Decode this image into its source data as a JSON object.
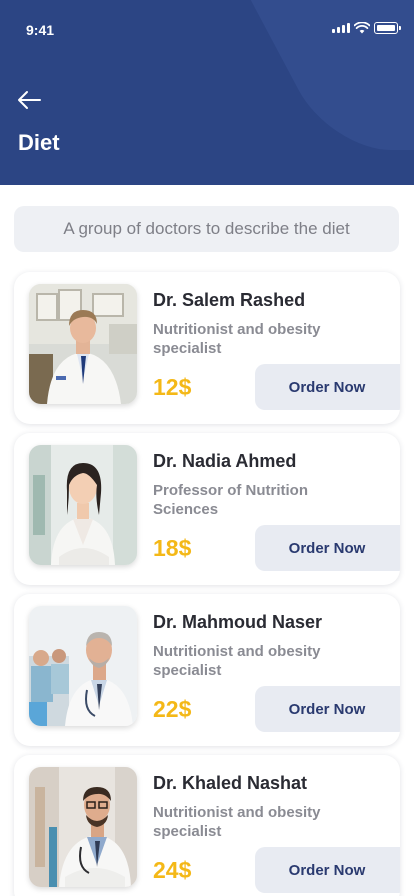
{
  "status_bar": {
    "time": "9:41"
  },
  "header": {
    "title": "Diet",
    "back_icon": "arrow-left-icon"
  },
  "subtitle": "A group of doctors to describe the diet",
  "colors": {
    "header_bg": "#2c4584",
    "price": "#f4b817",
    "button_bg": "#e8ebf2",
    "button_text": "#2a3a70"
  },
  "doctors": [
    {
      "name": "Dr. Salem Rashed",
      "specialty": "Nutritionist and obesity specialist",
      "price": "12$",
      "button_label": "Order Now"
    },
    {
      "name": "Dr. Nadia Ahmed",
      "specialty": "Professor of Nutrition Sciences",
      "price": "18$",
      "button_label": "Order Now"
    },
    {
      "name": "Dr. Mahmoud Naser",
      "specialty": "Nutritionist and obesity specialist",
      "price": "22$",
      "button_label": "Order Now"
    },
    {
      "name": "Dr. Khaled Nashat",
      "specialty": "Nutritionist and obesity specialist",
      "price": "24$",
      "button_label": "Order Now"
    }
  ]
}
